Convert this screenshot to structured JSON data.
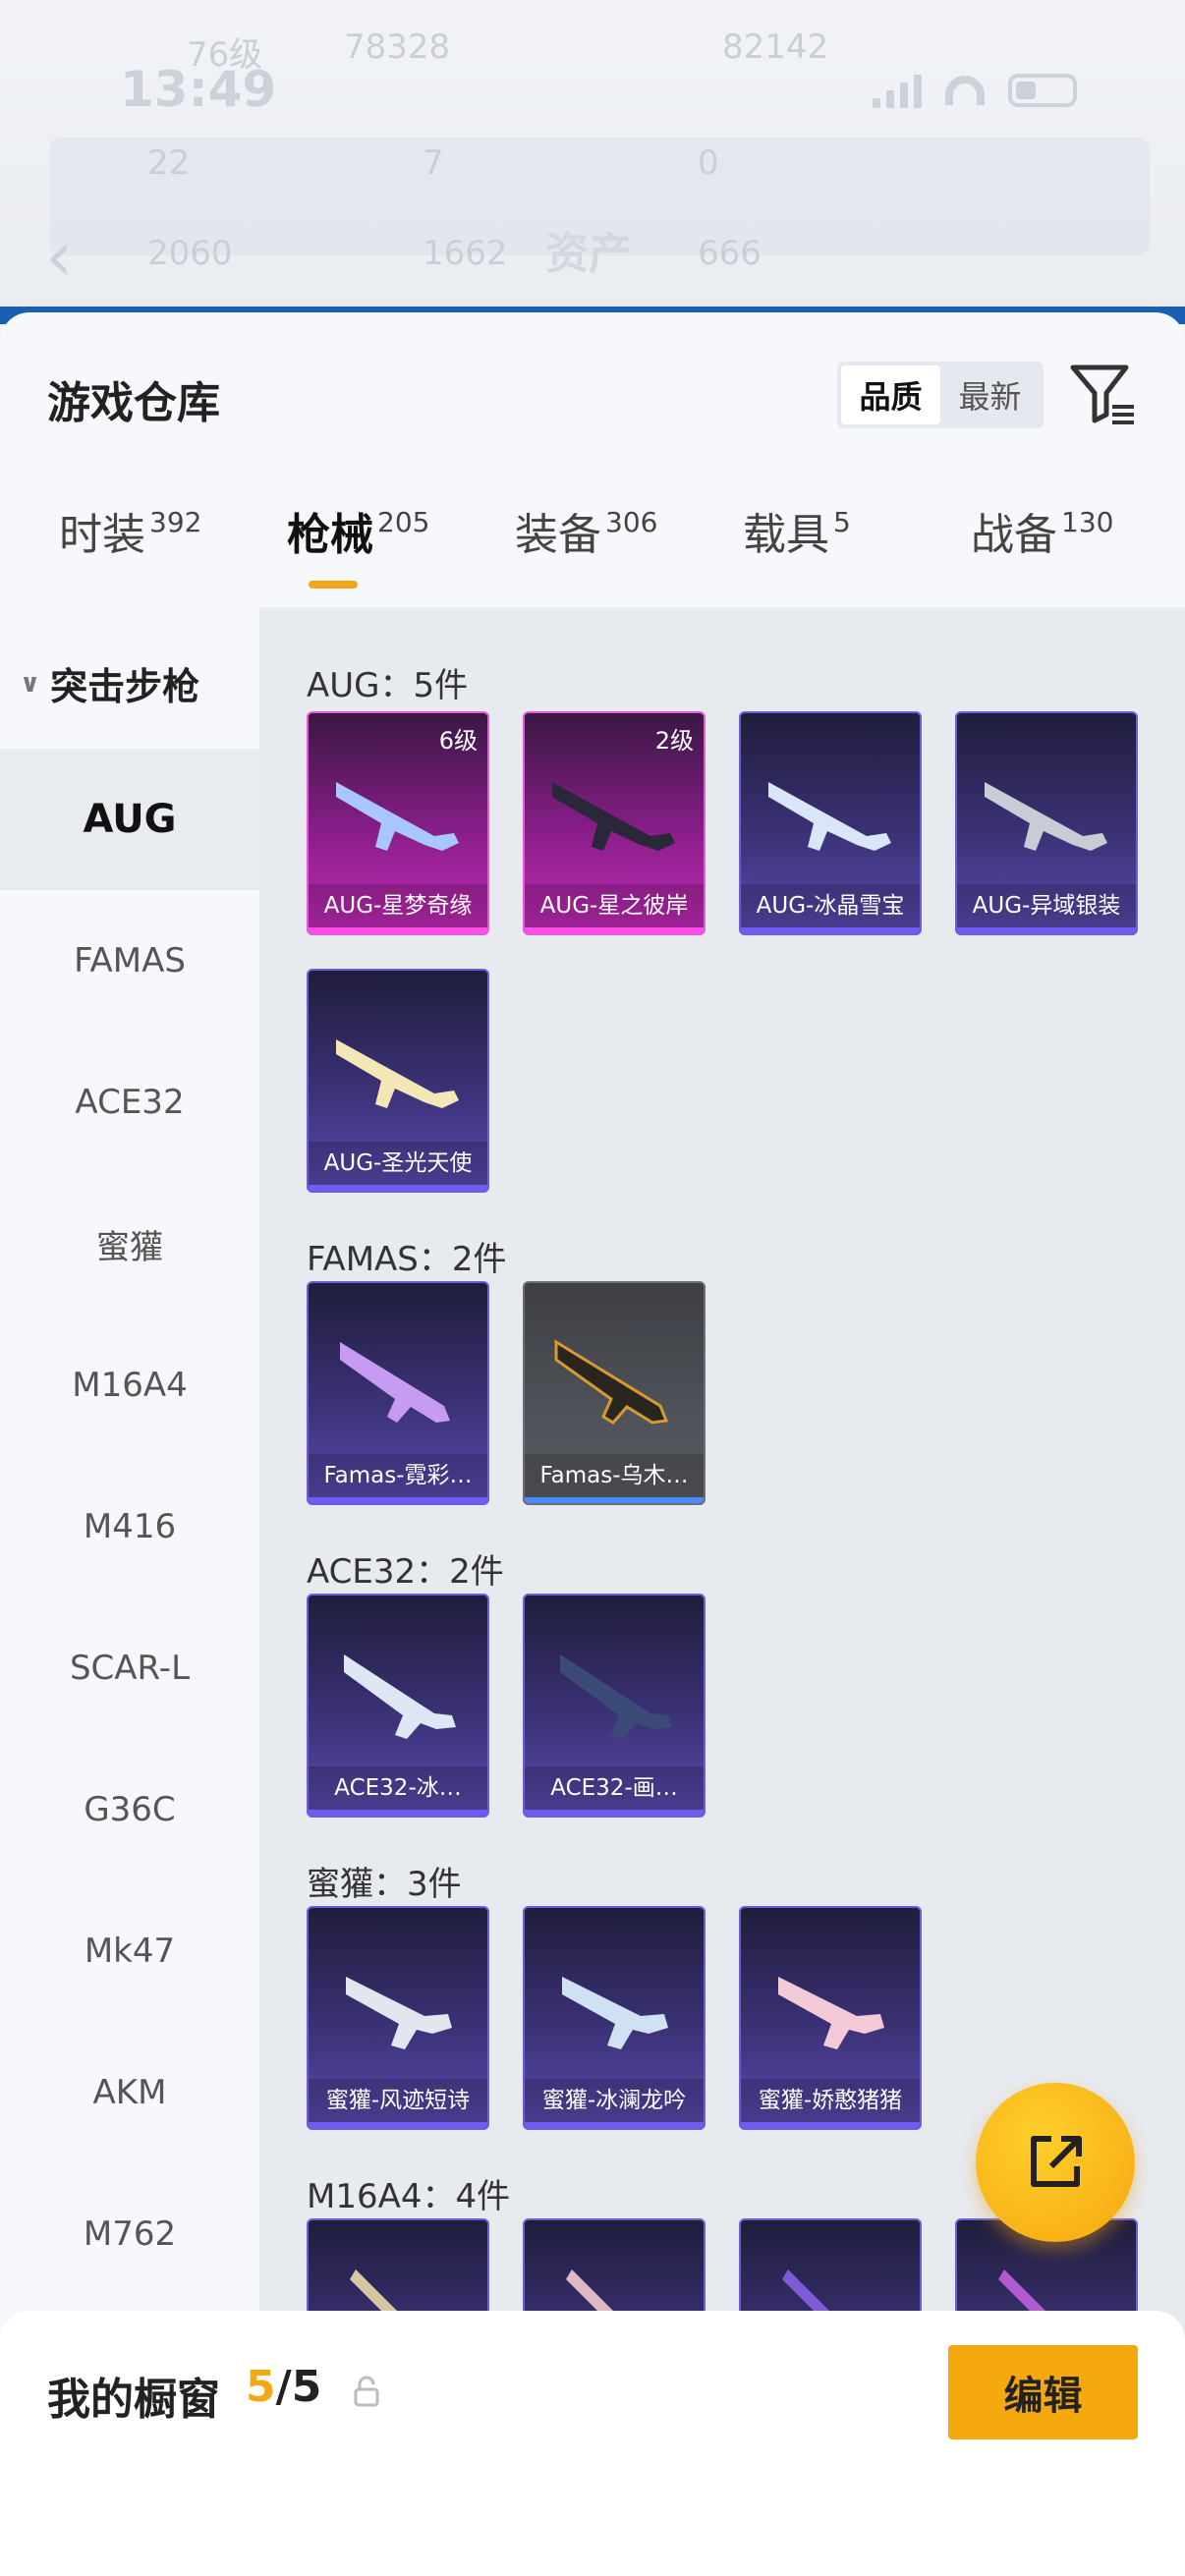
{
  "status_bar": {
    "time": "13:49"
  },
  "background_header": {
    "title": "资产",
    "faint_values": [
      "76级",
      "78328",
      "82142",
      "22",
      "7",
      "0",
      "2060",
      "1662",
      "666"
    ]
  },
  "sheet": {
    "title": "游戏仓库",
    "sort_options": [
      "品质",
      "最新"
    ],
    "sort_selected": "品质"
  },
  "tabs": [
    {
      "label": "时装",
      "count": "392"
    },
    {
      "label": "枪械",
      "count": "205"
    },
    {
      "label": "装备",
      "count": "306"
    },
    {
      "label": "载具",
      "count": "5"
    },
    {
      "label": "战备",
      "count": "130"
    }
  ],
  "active_tab": "枪械",
  "category": {
    "title": "突击步枪"
  },
  "weapon_list": [
    "AUG",
    "FAMAS",
    "ACE32",
    "蜜獾",
    "M16A4",
    "M416",
    "SCAR-L",
    "G36C",
    "Mk47",
    "AKM",
    "M762"
  ],
  "selected_weapon": "AUG",
  "groups": [
    {
      "title": "AUG：5件",
      "items": [
        {
          "name": "AUG-星梦奇缘",
          "level": "6级",
          "rarity": "pink"
        },
        {
          "name": "AUG-星之彼岸",
          "level": "2级",
          "rarity": "pink"
        },
        {
          "name": "AUG-冰晶雪宝",
          "level": "",
          "rarity": "purple"
        },
        {
          "name": "AUG-异域银装",
          "level": "",
          "rarity": "purple"
        },
        {
          "name": "AUG-圣光天使",
          "level": "",
          "rarity": "purple"
        }
      ]
    },
    {
      "title": "FAMAS：2件",
      "items": [
        {
          "name": "Famas-霓彩…",
          "level": "",
          "rarity": "purple"
        },
        {
          "name": "Famas-乌木…",
          "level": "",
          "rarity": "grey"
        }
      ]
    },
    {
      "title": "ACE32：2件",
      "items": [
        {
          "name": "ACE32-冰…",
          "level": "",
          "rarity": "purple"
        },
        {
          "name": "ACE32-画…",
          "level": "",
          "rarity": "purple"
        }
      ]
    },
    {
      "title": "蜜獾：3件",
      "items": [
        {
          "name": "蜜獾-风迹短诗",
          "level": "",
          "rarity": "purple"
        },
        {
          "name": "蜜獾-冰澜龙吟",
          "level": "",
          "rarity": "purple"
        },
        {
          "name": "蜜獾-娇憨猪猪",
          "level": "",
          "rarity": "purple"
        }
      ]
    },
    {
      "title": "M16A4：4件",
      "items": [
        {
          "name": "",
          "level": "",
          "rarity": "purple"
        },
        {
          "name": "",
          "level": "",
          "rarity": "purple"
        },
        {
          "name": "",
          "level": "",
          "rarity": "purple"
        },
        {
          "name": "",
          "level": "",
          "rarity": "purple"
        }
      ]
    }
  ],
  "showcase": {
    "label": "我的橱窗",
    "current": "5",
    "separator": "/",
    "total": "5",
    "edit_label": "编辑"
  },
  "icons": {
    "back": "back-arrow-icon",
    "filter": "filter-icon",
    "share": "share-external-icon",
    "lock": "lock-icon"
  },
  "colors": {
    "accent": "#f5a816",
    "rarity_pink": "#c42bb8",
    "rarity_purple": "#5b4ab0",
    "rarity_grey": "#5b5d64"
  }
}
